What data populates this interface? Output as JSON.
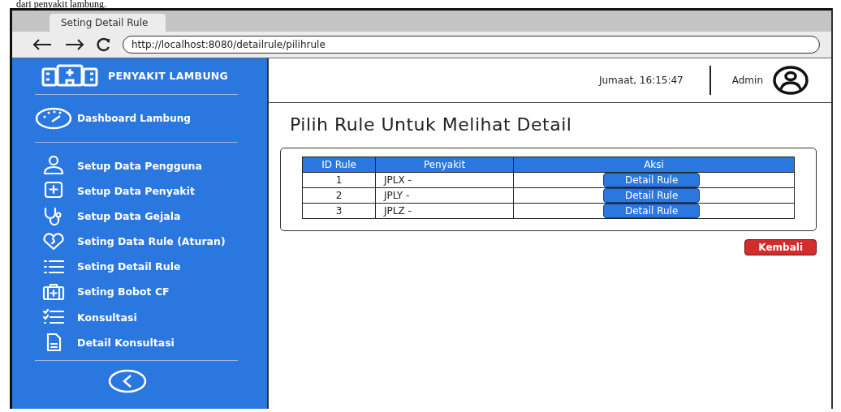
{
  "caption": "dari penyakit lambung.",
  "browser": {
    "tab_title": "Seting Detail Rule",
    "url": "http://localhost:8080/detailrule/pilihrule"
  },
  "sidebar": {
    "brand": "PENYAKIT LAMBUNG",
    "dashboard": "Dashboard Lambung",
    "items": [
      {
        "label": "Setup Data Pengguna"
      },
      {
        "label": "Setup Data Penyakit"
      },
      {
        "label": "Setup Data Gejala"
      },
      {
        "label": "Seting Data Rule (Aturan)"
      },
      {
        "label": "Seting Detail Rule"
      },
      {
        "label": "Seting Bobot CF"
      },
      {
        "label": "Konsultasi"
      },
      {
        "label": "Detail Konsultasi"
      }
    ]
  },
  "header": {
    "datetime": "Jumaat, 16:15:47",
    "user": "Admin"
  },
  "page_title": "Pilih Rule Untuk Melihat Detail",
  "table": {
    "columns": [
      "ID Rule",
      "Penyakit",
      "Aksi"
    ],
    "rows": [
      {
        "id": "1",
        "penyakit": "JPLX -",
        "action": "Detail Rule"
      },
      {
        "id": "2",
        "penyakit": "JPLY -",
        "action": "Detail Rule"
      },
      {
        "id": "3",
        "penyakit": "JPLZ -",
        "action": "Detail Rule"
      }
    ]
  },
  "back_button": "Kembali"
}
